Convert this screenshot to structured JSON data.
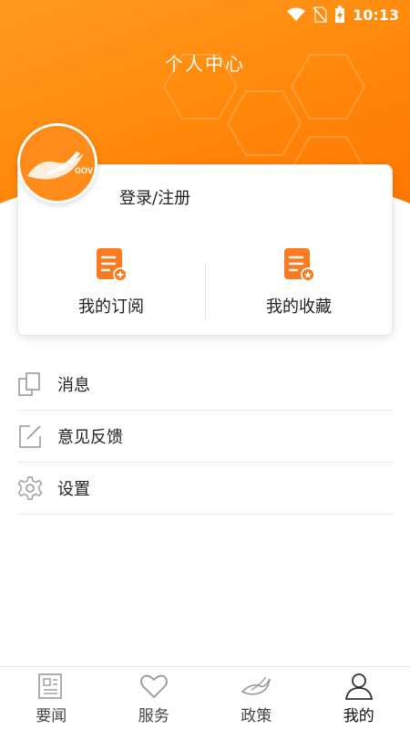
{
  "status_bar": {
    "time": "10:13",
    "icons": [
      "wifi-icon",
      "no-sim-icon",
      "battery-charging-icon"
    ]
  },
  "header": {
    "title": "个人中心",
    "accent": "#ff8a0c"
  },
  "profile": {
    "avatar_text": "GOV",
    "login_label": "登录/注册"
  },
  "quick_actions": [
    {
      "label": "我的订阅",
      "icon": "subscribe-document-icon"
    },
    {
      "label": "我的收藏",
      "icon": "favorite-document-icon"
    }
  ],
  "menu": [
    {
      "label": "消息",
      "icon": "message-icon"
    },
    {
      "label": "意见反馈",
      "icon": "feedback-edit-icon"
    },
    {
      "label": "设置",
      "icon": "gear-icon"
    }
  ],
  "tabs": [
    {
      "label": "要闻",
      "icon": "news-icon"
    },
    {
      "label": "服务",
      "icon": "heart-icon"
    },
    {
      "label": "政策",
      "icon": "policy-bird-icon"
    },
    {
      "label": "我的",
      "icon": "user-icon",
      "active": true
    }
  ]
}
